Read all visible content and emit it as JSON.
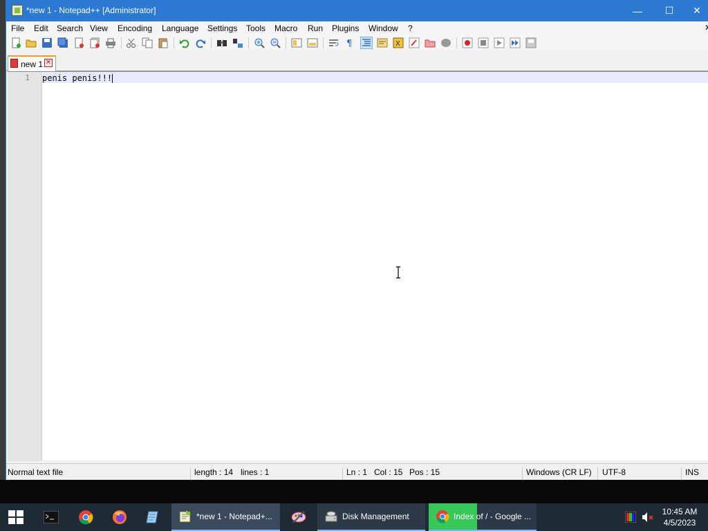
{
  "window": {
    "title": "*new 1 - Notepad++ [Administrator]",
    "controls": {
      "minimize": "—",
      "maximize": "☐",
      "close": "✕"
    }
  },
  "menu": [
    "File",
    "Edit",
    "Search",
    "View",
    "Encoding",
    "Language",
    "Settings",
    "Tools",
    "Macro",
    "Run",
    "Plugins",
    "Window",
    "?"
  ],
  "menu_close": "✕",
  "tab": {
    "label": "new 1",
    "close": "✕"
  },
  "editor": {
    "line_number": "1",
    "text": "penis penis!!!"
  },
  "status": {
    "file_type": "Normal text file",
    "length": "length : 14",
    "lines": "lines : 1",
    "ln": "Ln : 1",
    "col": "Col : 15",
    "pos": "Pos : 15",
    "eol": "Windows (CR LF)",
    "encoding": "UTF-8",
    "mode": "INS"
  },
  "taskbar": {
    "apps": [
      {
        "icon": "cmd-icon"
      },
      {
        "icon": "chrome-icon"
      },
      {
        "icon": "firefox-icon"
      },
      {
        "icon": "notepad-icon"
      },
      {
        "icon": "notepadpp-icon",
        "label": "*new 1 - Notepad+..."
      },
      {
        "icon": "paint-icon"
      },
      {
        "icon": "disk-management-icon",
        "label": "Disk Management"
      },
      {
        "icon": "chrome-icon",
        "label": "Index of / - Google ..."
      }
    ],
    "clock": {
      "time": "10:45 AM",
      "date": "4/5/2023"
    }
  },
  "colors": {
    "titlebar": "#2b79d3",
    "taskbar": "#1f2a35",
    "caret_line": "#e8e8ff",
    "tab_accent": "#f59b1e"
  }
}
